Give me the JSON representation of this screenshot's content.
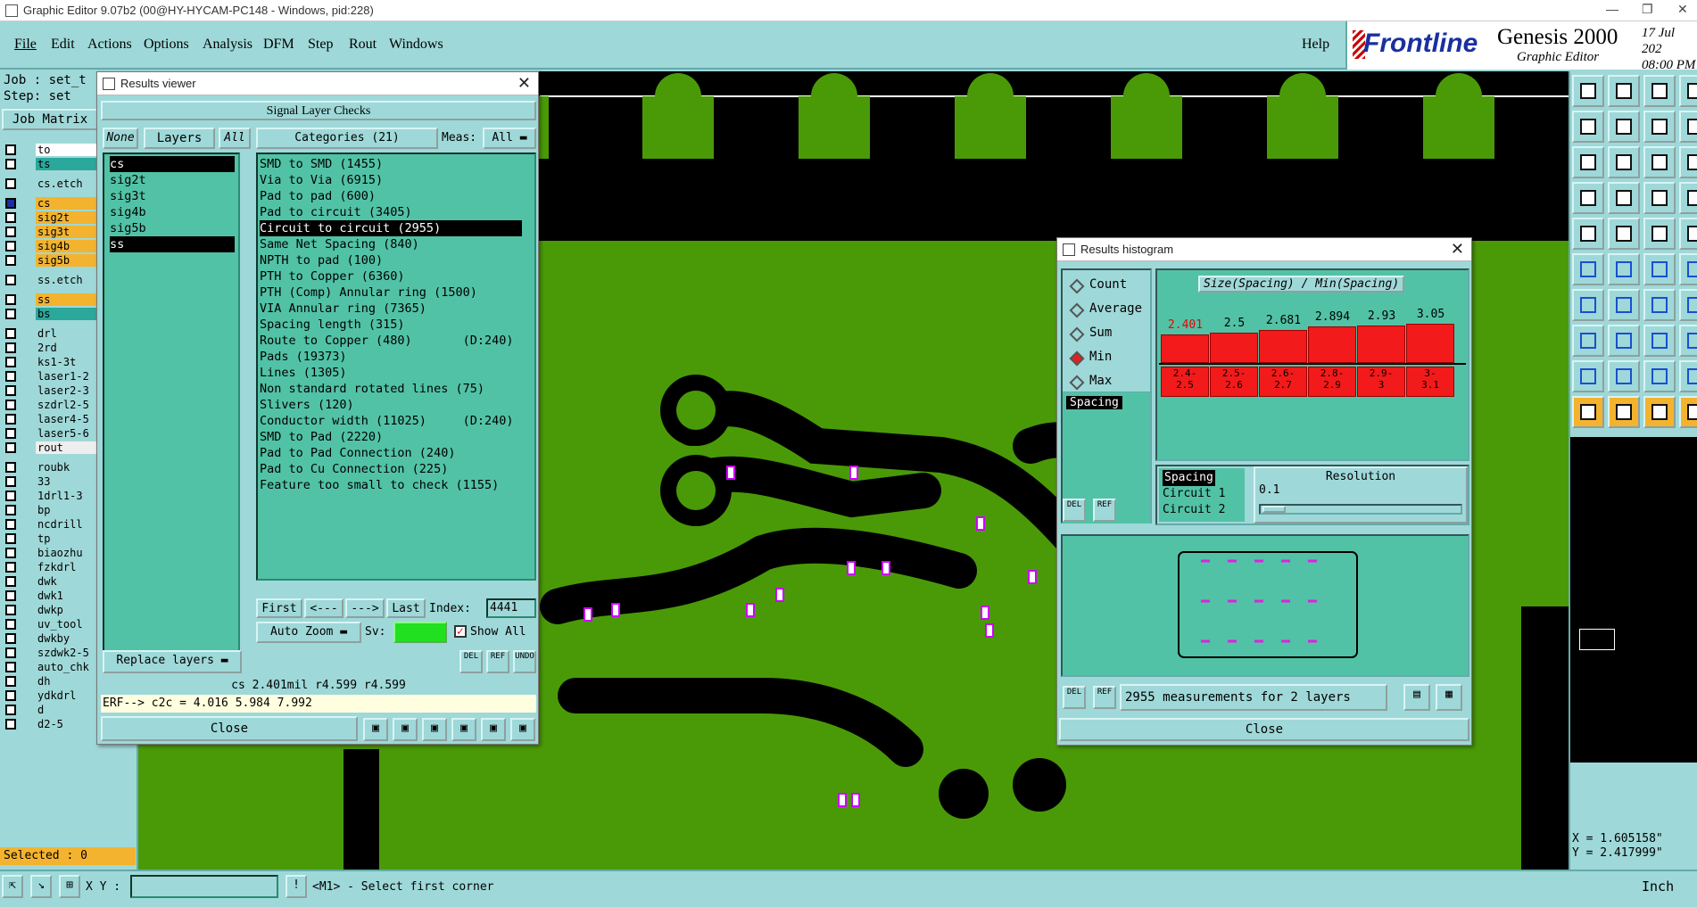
{
  "window": {
    "title": "Graphic Editor 9.07b2 (00@HY-HYCAM-PC148 - Windows, pid:228)"
  },
  "menu": [
    "File",
    "Edit",
    "Actions",
    "Options",
    "Analysis",
    "DFM",
    "Step",
    "Rout",
    "Windows"
  ],
  "help": "Help",
  "brand": {
    "logo": "Frontline",
    "product": "Genesis 2000",
    "sub": "Graphic Editor",
    "date": "17 Jul 202",
    "time": "08:00 PM"
  },
  "job": {
    "job": "Job : set_t",
    "step": "Step: set",
    "matrix": "Job Matrix"
  },
  "layers": [
    "to",
    "ts",
    "cs.etch",
    "cs",
    "sig2t",
    "sig3t",
    "sig4b",
    "sig5b",
    "ss.etch",
    "ss",
    "bs",
    "drl",
    "2rd",
    "ks1-3t",
    "laser1-2",
    "laser2-3",
    "szdrl2-5",
    "laser4-5",
    "laser5-6",
    "rout",
    "roubk",
    "33",
    "1drl1-3",
    "bp",
    "ncdrill",
    "tp",
    "biaozhu",
    "fzkdrl",
    "dwk",
    "dwk1",
    "dwkp",
    "uv_tool",
    "dwkby",
    "szdwk2-5",
    "auto_chk",
    "dh",
    "ydkdrl",
    "d",
    "d2-5"
  ],
  "selected": "Selected : 0",
  "results": {
    "title": "Results viewer",
    "header": "Signal Layer Checks",
    "none": "None",
    "layers": "Layers",
    "all": "All",
    "categories_title": "Categories (21)",
    "meas_label": "Meas:",
    "meas_value": "All",
    "layer_list": [
      "cs",
      "sig2t",
      "sig3t",
      "sig4b",
      "sig5b",
      "ss"
    ],
    "categories": [
      "SMD to SMD (1455)",
      "Via to Via (6915)",
      "Pad to pad (600)",
      "Pad to circuit (3405)",
      "Circuit to circuit (2955)",
      "Same Net Spacing (840)",
      "NPTH to pad (100)",
      "PTH to Copper (6360)",
      "PTH (Comp) Annular ring (1500)",
      "VIA Annular ring (7365)",
      "Spacing length (315)",
      "Route to Copper (480)       (D:240)",
      "Pads (19373)",
      "Lines (1305)",
      "Non standard rotated lines (75)",
      "Slivers (120)",
      "Conductor width (11025)     (D:240)",
      "SMD to Pad (2220)",
      "Pad to Pad Connection (240)",
      "Pad to Cu Connection (225)",
      "Feature too small to check (1155)"
    ],
    "first": "First",
    "prev": "<---",
    "next": "--->",
    "last": "Last",
    "index_label": "Index:",
    "index_value": "4441",
    "auto_zoom": "Auto Zoom",
    "sv": "Sv:",
    "show_all": "Show All",
    "replace": "Replace layers",
    "del": "DEL",
    "ref": "REF",
    "undo": "UNDO",
    "info": "cs 2.401mil  r4.599  r4.599",
    "erf": "ERF--> c2c = 4.016 5.984 7.992",
    "close": "Close"
  },
  "histogram": {
    "title": "Results histogram",
    "options": [
      "Count",
      "Average",
      "Sum",
      "Min",
      "Max"
    ],
    "selected_option": "Min",
    "chart_title": "Size(Spacing) / Min(Spacing)",
    "spacing": "Spacing",
    "values": [
      "2.401",
      "2.5",
      "2.681",
      "2.894",
      "2.93",
      "3.05"
    ],
    "ranges": [
      "2.4-\n2.5",
      "2.5-\n2.6",
      "2.6-\n2.7",
      "2.8-\n2.9",
      "2.9-\n3",
      "3-\n3.1"
    ],
    "sublist": [
      "Spacing",
      "Circuit 1",
      "Circuit 2"
    ],
    "resolution": "Resolution",
    "res_value": "0.1",
    "del": "DEL",
    "ref": "REF",
    "measurements": "2955 measurements for 2 layers",
    "close": "Close"
  },
  "status": {
    "xy_label": "X Y :",
    "prompt": "<M1> - Select first corner",
    "units": "Inch"
  },
  "coords": {
    "x": "X = 1.605158\"",
    "y": "Y = 2.417999\""
  }
}
